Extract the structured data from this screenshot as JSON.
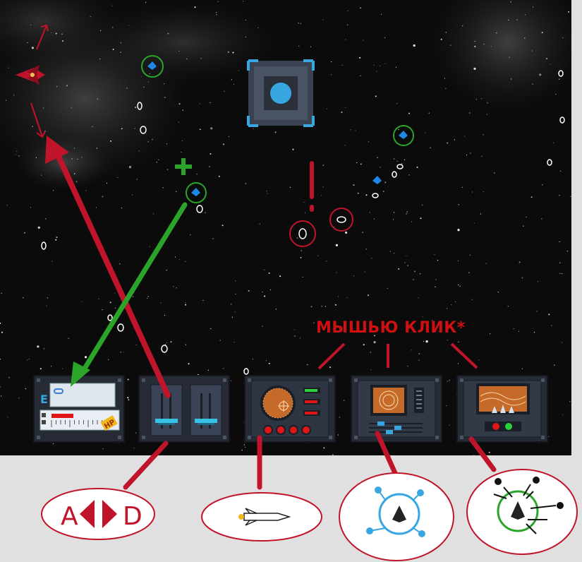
{
  "hint_caption": "МЫШЬЮ КЛИК*",
  "control_hints": {
    "steer_keys": {
      "left_key": "A",
      "right_key": "D"
    },
    "fire_icon": "missile-icon",
    "shield_icon": "shield-ship-icon",
    "scatter_icon": "multi-target-ship-icon"
  },
  "panels": [
    {
      "name": "energy-hp-panel",
      "e_label": "E",
      "hp_label": "HP",
      "hp_fraction": 0.35
    },
    {
      "name": "thrust-levers-panel"
    },
    {
      "name": "radar-weapons-panel",
      "lights": [
        "green",
        "red",
        "red"
      ],
      "buttons": 4
    },
    {
      "name": "shield-scanner-panel"
    },
    {
      "name": "scatter-scanner-panel"
    }
  ],
  "markers": {
    "alert": "!",
    "add": "+"
  },
  "colors": {
    "hint_red": "#d01010",
    "hint_green": "#2aa52a",
    "player_ship": "#c0142a",
    "ally_blue": "#1e88e5",
    "panel_bg": "#252a33"
  }
}
